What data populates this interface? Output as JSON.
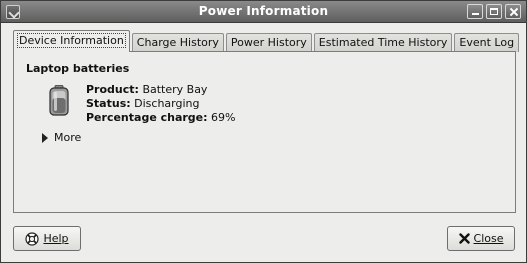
{
  "window": {
    "title": "Power Information"
  },
  "tabs": [
    {
      "label": "Device Information"
    },
    {
      "label": "Charge History"
    },
    {
      "label": "Power History"
    },
    {
      "label": "Estimated Time History"
    },
    {
      "label": "Event Log"
    }
  ],
  "device": {
    "section_title": "Laptop batteries",
    "product_label": "Product:",
    "product_value": "Battery Bay",
    "status_label": "Status:",
    "status_value": "Discharging",
    "charge_label": "Percentage charge:",
    "charge_value": "69%",
    "more_label": "More"
  },
  "buttons": {
    "help_label": "Help",
    "close_label": "Close"
  },
  "icons": {
    "window": "app-icon",
    "battery": "battery-icon",
    "expander": "expander-triangle-icon",
    "help": "help-lifebuoy-icon",
    "close": "close-x-icon"
  }
}
